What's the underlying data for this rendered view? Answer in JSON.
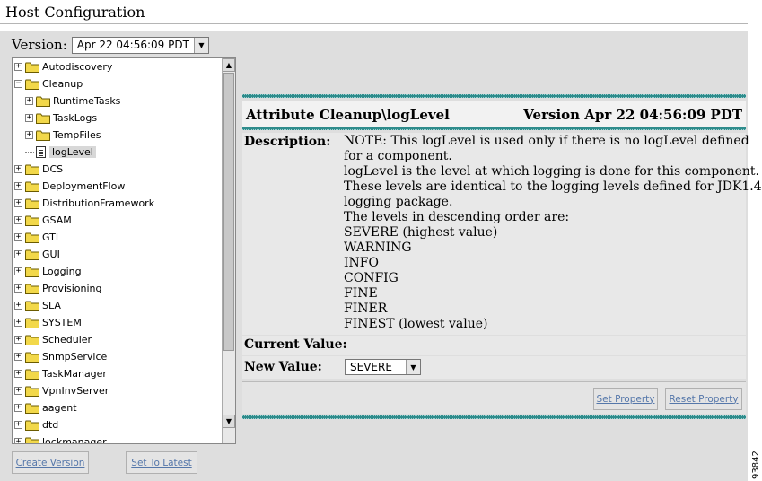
{
  "window": {
    "title": "Host Configuration"
  },
  "version": {
    "label": "Version:",
    "selected": "Apr 22 04:56:09 PDT"
  },
  "tree": {
    "items": [
      {
        "label": "Autodiscovery",
        "expander": "+"
      },
      {
        "label": "Cleanup",
        "expander": "−"
      },
      {
        "label": "RuntimeTasks",
        "expander": "+"
      },
      {
        "label": "TaskLogs",
        "expander": "+"
      },
      {
        "label": "TempFiles",
        "expander": "+"
      },
      {
        "label": "logLevel"
      },
      {
        "label": "DCS",
        "expander": "+"
      },
      {
        "label": "DeploymentFlow",
        "expander": "+"
      },
      {
        "label": "DistributionFramework",
        "expander": "+"
      },
      {
        "label": "GSAM",
        "expander": "+"
      },
      {
        "label": "GTL",
        "expander": "+"
      },
      {
        "label": "GUI",
        "expander": "+"
      },
      {
        "label": "Logging",
        "expander": "+"
      },
      {
        "label": "Provisioning",
        "expander": "+"
      },
      {
        "label": "SLA",
        "expander": "+"
      },
      {
        "label": "SYSTEM",
        "expander": "+"
      },
      {
        "label": "Scheduler",
        "expander": "+"
      },
      {
        "label": "SnmpService",
        "expander": "+"
      },
      {
        "label": "TaskManager",
        "expander": "+"
      },
      {
        "label": "VpnInvServer",
        "expander": "+"
      },
      {
        "label": "aagent",
        "expander": "+"
      },
      {
        "label": "dtd",
        "expander": "+"
      },
      {
        "label": "lockmanager",
        "expander": "+"
      }
    ]
  },
  "buttons": {
    "create_version": "Create Version",
    "set_to_latest": "Set To Latest",
    "set_property": "Set Property",
    "reset_property": "Reset Property"
  },
  "attribute": {
    "title": "Attribute Cleanup\\logLevel",
    "version": "Version Apr 22 04:56:09 PDT",
    "description_label": "Description:",
    "description_lines": [
      "NOTE: This logLevel is used only if there is no logLevel defined",
      "for a component.",
      "logLevel is the level at which logging is done for this component.",
      "These levels are identical to the logging levels defined for JDK1.4",
      "logging package.",
      "The levels in descending order are:",
      "SEVERE (highest value)",
      "WARNING",
      "INFO",
      "CONFIG",
      "FINE",
      "FINER",
      "FINEST (lowest value)"
    ],
    "current_value_label": "Current Value:",
    "current_value": "",
    "new_value_label": "New Value:",
    "new_value": "SEVERE"
  },
  "figure_number": "93842",
  "colors": {
    "panel": "#dedede",
    "teal": "#2f8c8c",
    "folder": "#f2d84a",
    "link": "#5577aa"
  },
  "icons": {
    "folder": "folder-icon",
    "leaf": "document-icon",
    "expand": "plus-box-icon",
    "collapse": "minus-box-icon"
  }
}
